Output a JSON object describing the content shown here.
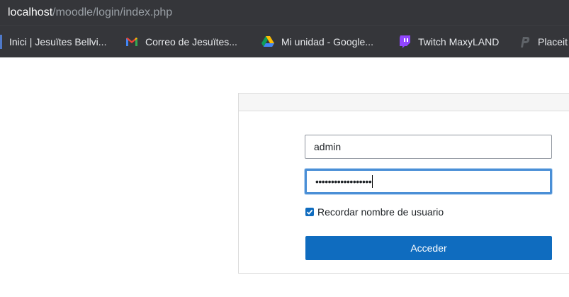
{
  "browser": {
    "url_host": "localhost",
    "url_path": "/moodle/login/index.php"
  },
  "bookmarks": [
    {
      "label": "Inici | Jesuïtes Bellvi...",
      "icon": "bookmark-color-bar-icon"
    },
    {
      "label": "Correo de Jesuïtes...",
      "icon": "gmail-icon"
    },
    {
      "label": "Mi unidad - Google...",
      "icon": "google-drive-icon"
    },
    {
      "label": "Twitch MaxyLAND",
      "icon": "twitch-icon"
    },
    {
      "label": "Placeit",
      "icon": "placeit-icon"
    }
  ],
  "login": {
    "username_value": "admin",
    "password_value": "••••••••••••••••••",
    "remember_label": "Recordar nombre de usuario",
    "remember_checked": true,
    "submit_label": "Acceder"
  },
  "colors": {
    "browser_chrome": "#35363a",
    "primary": "#0f6cbf",
    "focus_ring": "#4a8fd6"
  }
}
